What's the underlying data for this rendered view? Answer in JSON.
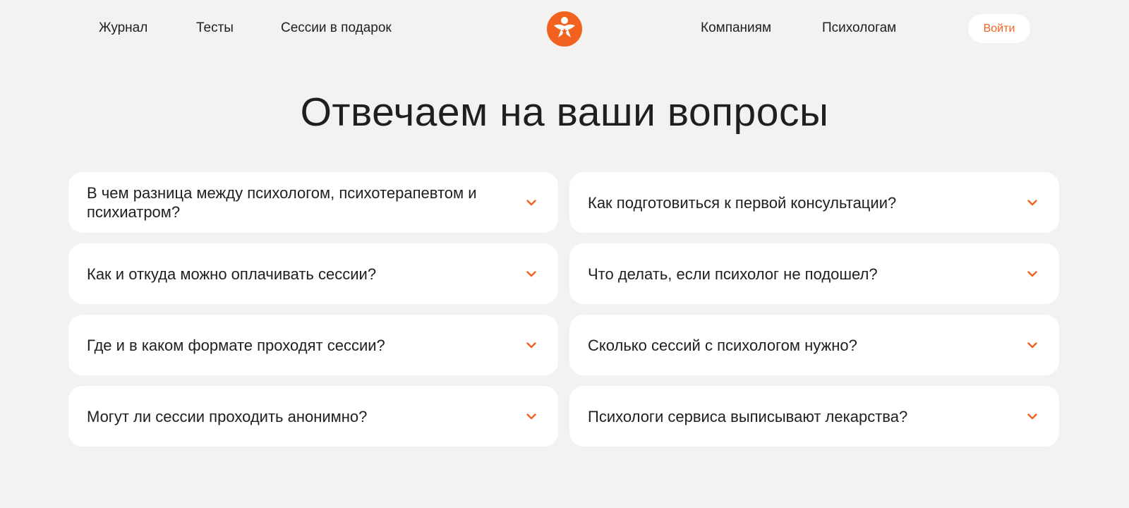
{
  "nav": {
    "left": [
      {
        "label": "Журнал"
      },
      {
        "label": "Тесты"
      },
      {
        "label": "Сессии в подарок"
      }
    ],
    "right": [
      {
        "label": "Компаниям"
      },
      {
        "label": "Психологам"
      }
    ],
    "login_label": "Войти",
    "logo_icon": "person-star-logo-icon"
  },
  "colors": {
    "background": "#f3f2f0",
    "card": "#ffffff",
    "accent": "#f2621f",
    "text": "#1f1f1f"
  },
  "main": {
    "title": "Отвечаем на ваши вопросы"
  },
  "faq": [
    {
      "question": "В чем разница между психологом, психотерапевтом и психиатром?"
    },
    {
      "question": "Как подготовиться к первой консультации?"
    },
    {
      "question": "Как и откуда можно оплачивать сессии?"
    },
    {
      "question": "Что делать, если психолог не подошел?"
    },
    {
      "question": "Где и в каком формате проходят сессии?"
    },
    {
      "question": "Сколько сессий с психологом нужно?"
    },
    {
      "question": "Могут ли сессии проходить анонимно?"
    },
    {
      "question": "Психологи сервиса выписывают лекарства?"
    }
  ],
  "icons": {
    "expand": "chevron-down-icon"
  }
}
